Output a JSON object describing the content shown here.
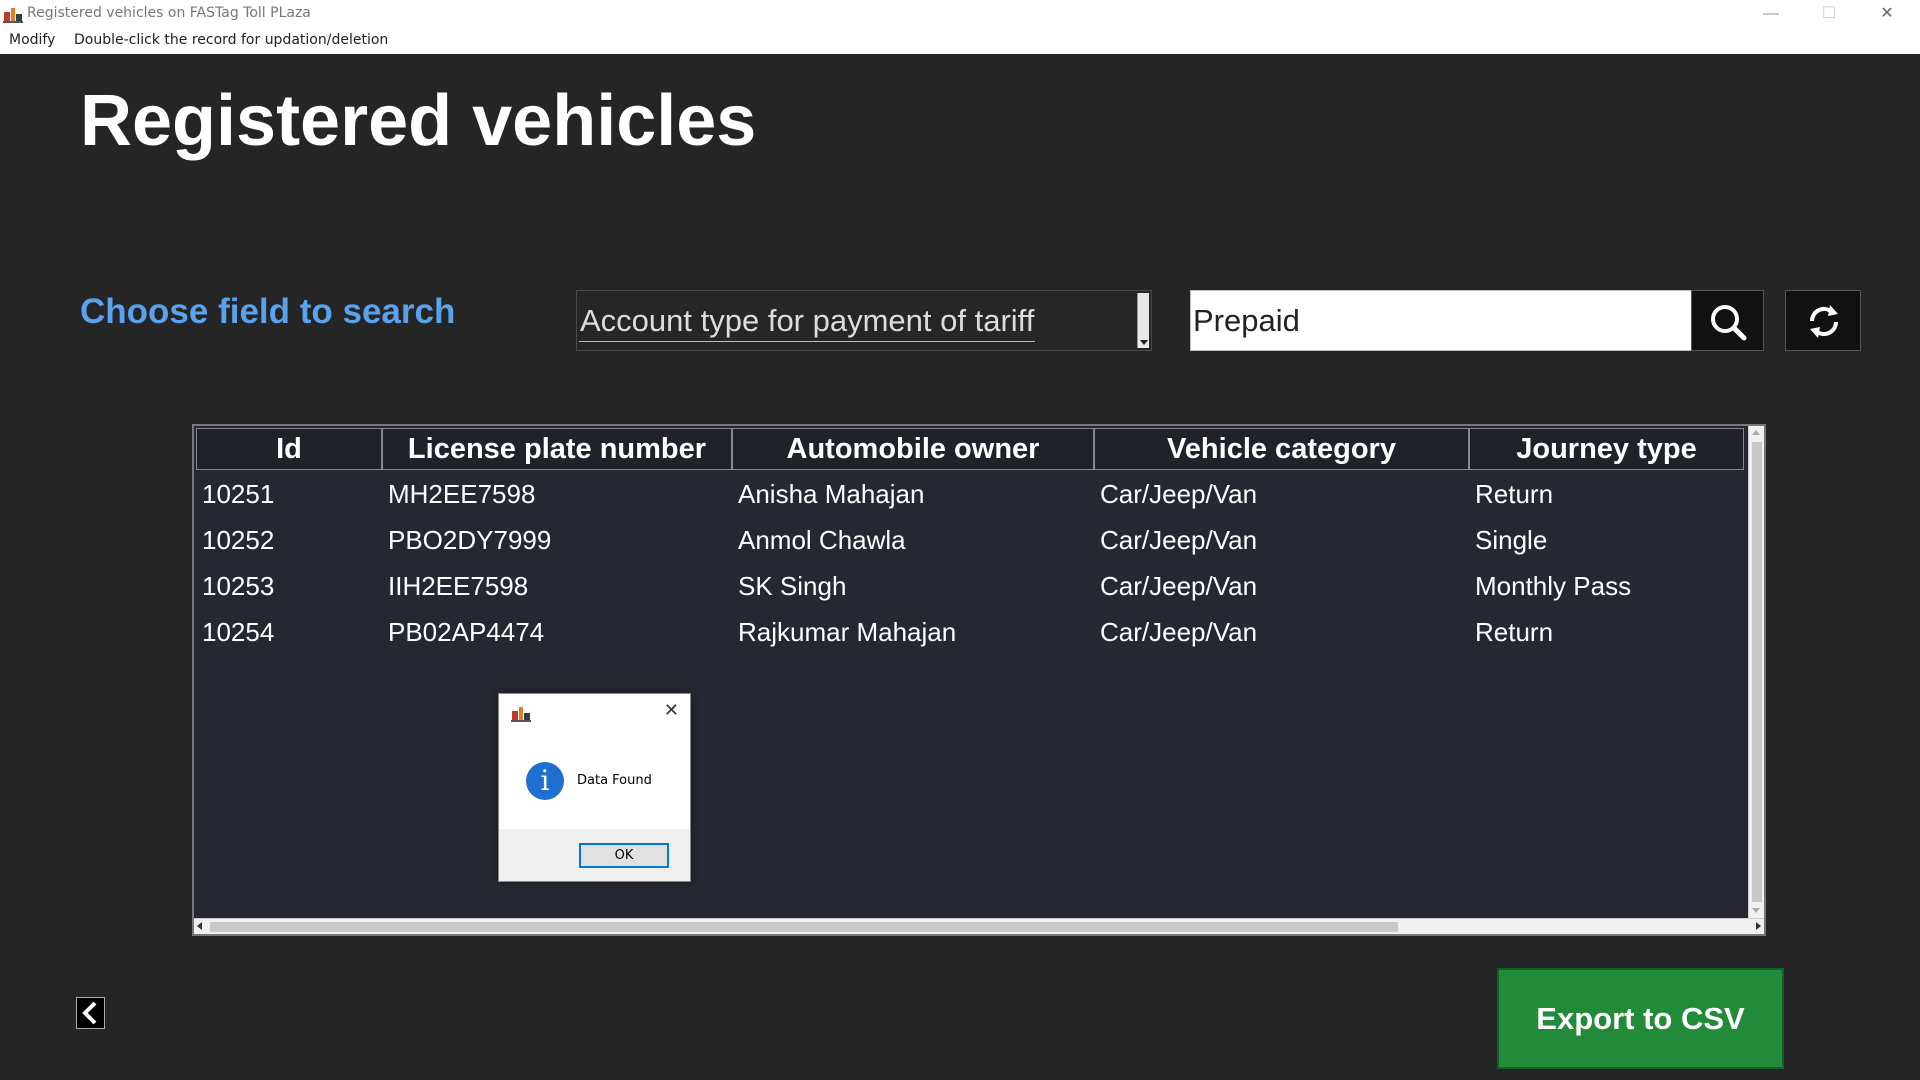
{
  "window": {
    "title": "Registered vehicles on FASTag Toll PLaza",
    "minimize": "—",
    "maximize": "☐",
    "close": "✕"
  },
  "menubar": {
    "items": [
      {
        "label": "Modify"
      },
      {
        "label": "Double-click the record for updation/deletion"
      }
    ]
  },
  "main": {
    "title": "Registered vehicles",
    "search_label": "Choose field to search",
    "search_field": "Account type for payment of tariff",
    "search_value": "Prepaid"
  },
  "table": {
    "columns": [
      "Id",
      "License plate number",
      "Automobile owner",
      "Vehicle category",
      "Journey type"
    ],
    "rows": [
      [
        "10251",
        "MH2EE7598",
        "Anisha Mahajan",
        "Car/Jeep/Van",
        "Return"
      ],
      [
        "10252",
        "PBO2DY7999",
        "Anmol Chawla",
        "Car/Jeep/Van",
        "Single"
      ],
      [
        "10253",
        "IIH2EE7598",
        "SK Singh",
        "Car/Jeep/Van",
        "Monthly Pass"
      ],
      [
        "10254",
        "PB02AP4474",
        "Rajkumar Mahajan",
        "Car/Jeep/Van",
        "Return"
      ]
    ]
  },
  "dialog": {
    "message": "Data Found",
    "ok_label": "OK",
    "close": "✕"
  },
  "footer": {
    "export_label": "Export to CSV"
  },
  "colors": {
    "background": "#252525",
    "accent_label": "#5aa1ee",
    "export_button": "#228b3a",
    "info_icon": "#1f6fd0"
  },
  "icons": [
    "app-icon",
    "search-icon",
    "refresh-icon",
    "back-arrow-icon",
    "info-icon",
    "close-icon"
  ]
}
